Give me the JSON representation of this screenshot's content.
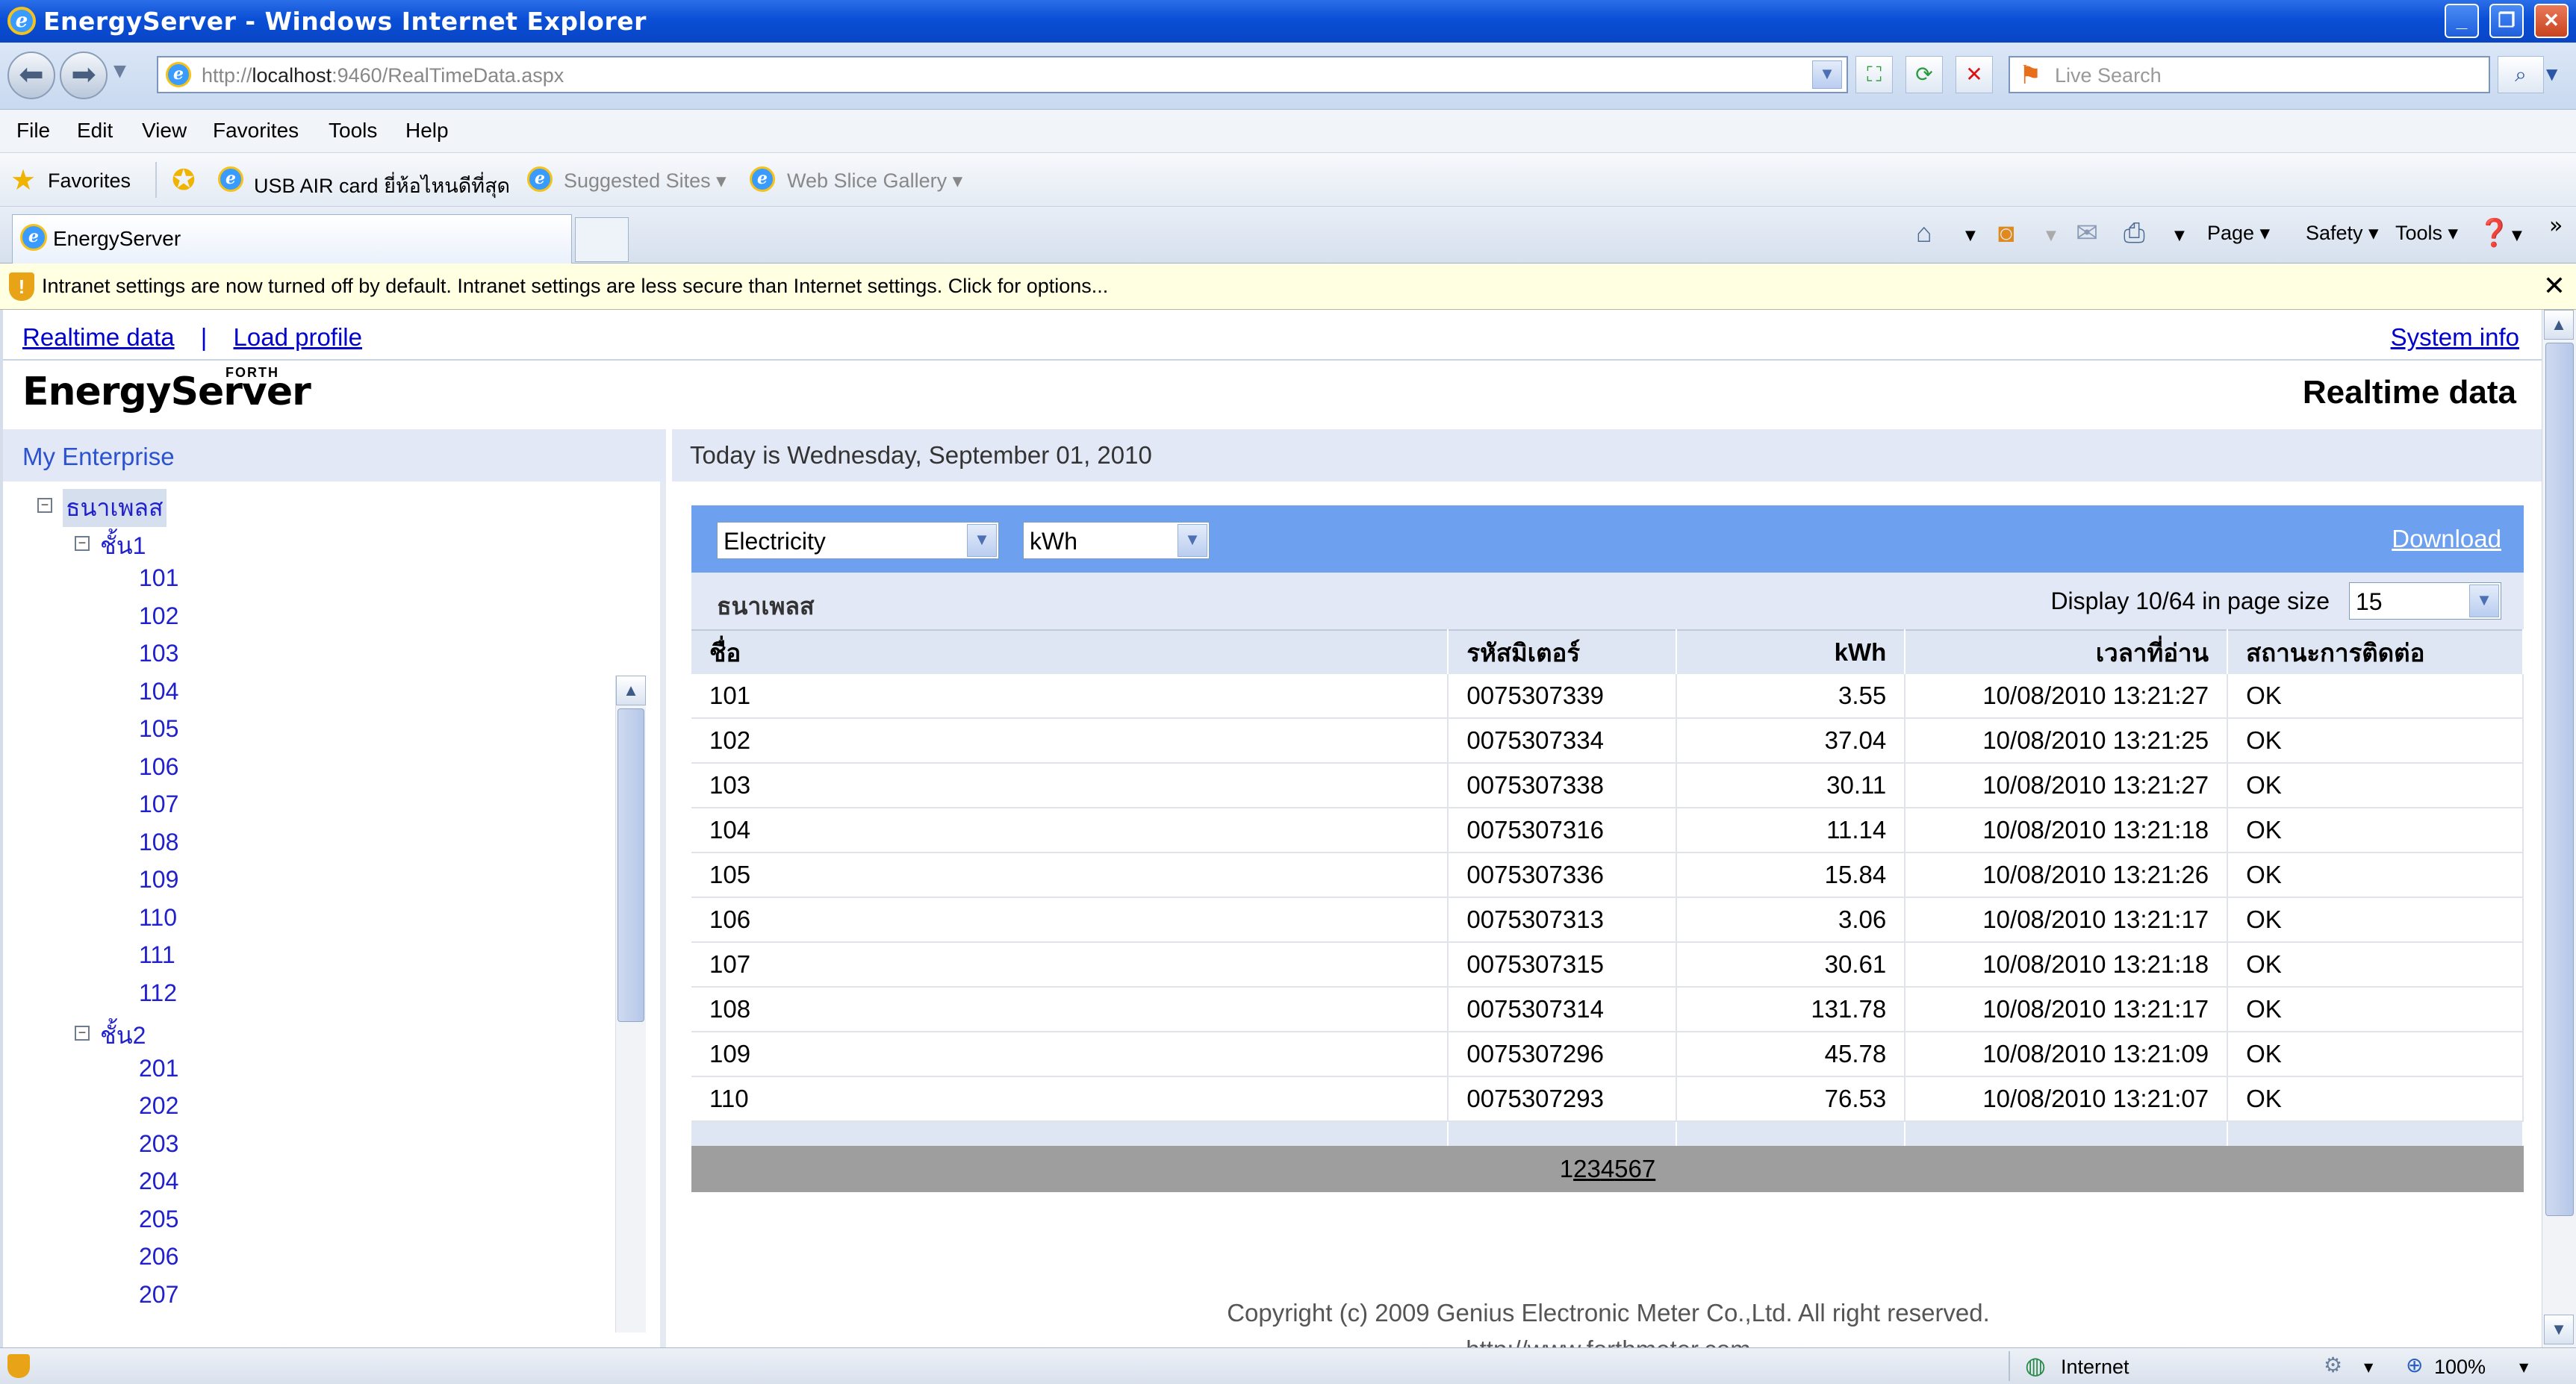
{
  "window": {
    "title": "EnergyServer - Windows Internet Explorer"
  },
  "nav": {
    "address": "http://localhost:9460/RealTimeData.aspx",
    "address_host": "localhost",
    "address_prefix": "http://",
    "address_suffix": ":9460/RealTimeData.aspx",
    "search_placeholder": "Live Search"
  },
  "menu": [
    "File",
    "Edit",
    "View",
    "Favorites",
    "Tools",
    "Help"
  ],
  "favorites": {
    "label": "Favorites",
    "items": [
      "USB AIR card ยี่ห้อไหนดีที่สุด",
      "Suggested Sites ▾",
      "Web Slice Gallery ▾"
    ]
  },
  "tab": {
    "label": "EnergyServer"
  },
  "commands": {
    "page": "Page ▾",
    "safety": "Safety ▾",
    "tools": "Tools ▾"
  },
  "infobar": {
    "text": "Intranet settings are now turned off by default. Intranet settings are less secure than Internet settings. Click for options..."
  },
  "page": {
    "nav_realtime": "Realtime data",
    "nav_sep": "|",
    "nav_load": "Load profile",
    "system_info": "System info",
    "logo_text": "EnergyServer",
    "logo_forth": "FORTH",
    "heading": "Realtime data",
    "enterprise": "My Enterprise",
    "date_text": "Today is Wednesday, September 01, 2010",
    "copyright": "Copyright (c) 2009 Genius Electronic Meter Co.,Ltd. All right reserved.",
    "website": "http://www.forthmeter.com"
  },
  "tree": {
    "root": "ธนาเพลส",
    "floors": [
      {
        "label": "ชั้น1",
        "rooms": [
          "101",
          "102",
          "103",
          "104",
          "105",
          "106",
          "107",
          "108",
          "109",
          "110",
          "111",
          "112"
        ]
      },
      {
        "label": "ชั้น2",
        "rooms": [
          "201",
          "202",
          "203",
          "204",
          "205",
          "206",
          "207"
        ]
      }
    ]
  },
  "filters": {
    "type": "Electricity",
    "unit": "kWh",
    "download": "Download"
  },
  "subhead": {
    "site": "ธนาเพลส",
    "display": "Display 10/64 in page size",
    "page_size": "15"
  },
  "table": {
    "headers": [
      "ชื่อ",
      "รหัสมิเตอร์",
      "kWh",
      "เวลาที่อ่าน",
      "สถานะการติดต่อ"
    ],
    "rows": [
      [
        "101",
        "0075307339",
        "3.55",
        "10/08/2010 13:21:27",
        "OK"
      ],
      [
        "102",
        "0075307334",
        "37.04",
        "10/08/2010 13:21:25",
        "OK"
      ],
      [
        "103",
        "0075307338",
        "30.11",
        "10/08/2010 13:21:27",
        "OK"
      ],
      [
        "104",
        "0075307316",
        "11.14",
        "10/08/2010 13:21:18",
        "OK"
      ],
      [
        "105",
        "0075307336",
        "15.84",
        "10/08/2010 13:21:26",
        "OK"
      ],
      [
        "106",
        "0075307313",
        "3.06",
        "10/08/2010 13:21:17",
        "OK"
      ],
      [
        "107",
        "0075307315",
        "30.61",
        "10/08/2010 13:21:18",
        "OK"
      ],
      [
        "108",
        "0075307314",
        "131.78",
        "10/08/2010 13:21:17",
        "OK"
      ],
      [
        "109",
        "0075307296",
        "45.78",
        "10/08/2010 13:21:09",
        "OK"
      ],
      [
        "110",
        "0075307293",
        "76.53",
        "10/08/2010 13:21:07",
        "OK"
      ]
    ]
  },
  "pager": {
    "current": "1",
    "pages": [
      "2",
      "3",
      "4",
      "5",
      "6",
      "7"
    ]
  },
  "status": {
    "zone": "Internet",
    "zoom": "100%"
  },
  "colors": {
    "title_bar": "#0a4fd6",
    "filter_bar": "#6ea0f0",
    "link": "#0000cc",
    "tree_link": "#2020cc",
    "pager": "#9e9e9e"
  }
}
